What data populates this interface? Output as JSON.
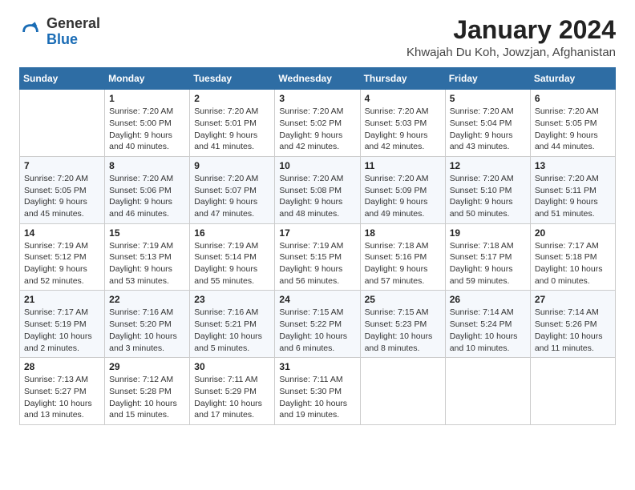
{
  "header": {
    "logo_general": "General",
    "logo_blue": "Blue",
    "month_year": "January 2024",
    "location": "Khwajah Du Koh, Jowzjan, Afghanistan"
  },
  "weekdays": [
    "Sunday",
    "Monday",
    "Tuesday",
    "Wednesday",
    "Thursday",
    "Friday",
    "Saturday"
  ],
  "weeks": [
    [
      {
        "day": "",
        "info": ""
      },
      {
        "day": "1",
        "info": "Sunrise: 7:20 AM\nSunset: 5:00 PM\nDaylight: 9 hours\nand 40 minutes."
      },
      {
        "day": "2",
        "info": "Sunrise: 7:20 AM\nSunset: 5:01 PM\nDaylight: 9 hours\nand 41 minutes."
      },
      {
        "day": "3",
        "info": "Sunrise: 7:20 AM\nSunset: 5:02 PM\nDaylight: 9 hours\nand 42 minutes."
      },
      {
        "day": "4",
        "info": "Sunrise: 7:20 AM\nSunset: 5:03 PM\nDaylight: 9 hours\nand 42 minutes."
      },
      {
        "day": "5",
        "info": "Sunrise: 7:20 AM\nSunset: 5:04 PM\nDaylight: 9 hours\nand 43 minutes."
      },
      {
        "day": "6",
        "info": "Sunrise: 7:20 AM\nSunset: 5:05 PM\nDaylight: 9 hours\nand 44 minutes."
      }
    ],
    [
      {
        "day": "7",
        "info": "Sunrise: 7:20 AM\nSunset: 5:05 PM\nDaylight: 9 hours\nand 45 minutes."
      },
      {
        "day": "8",
        "info": "Sunrise: 7:20 AM\nSunset: 5:06 PM\nDaylight: 9 hours\nand 46 minutes."
      },
      {
        "day": "9",
        "info": "Sunrise: 7:20 AM\nSunset: 5:07 PM\nDaylight: 9 hours\nand 47 minutes."
      },
      {
        "day": "10",
        "info": "Sunrise: 7:20 AM\nSunset: 5:08 PM\nDaylight: 9 hours\nand 48 minutes."
      },
      {
        "day": "11",
        "info": "Sunrise: 7:20 AM\nSunset: 5:09 PM\nDaylight: 9 hours\nand 49 minutes."
      },
      {
        "day": "12",
        "info": "Sunrise: 7:20 AM\nSunset: 5:10 PM\nDaylight: 9 hours\nand 50 minutes."
      },
      {
        "day": "13",
        "info": "Sunrise: 7:20 AM\nSunset: 5:11 PM\nDaylight: 9 hours\nand 51 minutes."
      }
    ],
    [
      {
        "day": "14",
        "info": "Sunrise: 7:19 AM\nSunset: 5:12 PM\nDaylight: 9 hours\nand 52 minutes."
      },
      {
        "day": "15",
        "info": "Sunrise: 7:19 AM\nSunset: 5:13 PM\nDaylight: 9 hours\nand 53 minutes."
      },
      {
        "day": "16",
        "info": "Sunrise: 7:19 AM\nSunset: 5:14 PM\nDaylight: 9 hours\nand 55 minutes."
      },
      {
        "day": "17",
        "info": "Sunrise: 7:19 AM\nSunset: 5:15 PM\nDaylight: 9 hours\nand 56 minutes."
      },
      {
        "day": "18",
        "info": "Sunrise: 7:18 AM\nSunset: 5:16 PM\nDaylight: 9 hours\nand 57 minutes."
      },
      {
        "day": "19",
        "info": "Sunrise: 7:18 AM\nSunset: 5:17 PM\nDaylight: 9 hours\nand 59 minutes."
      },
      {
        "day": "20",
        "info": "Sunrise: 7:17 AM\nSunset: 5:18 PM\nDaylight: 10 hours\nand 0 minutes."
      }
    ],
    [
      {
        "day": "21",
        "info": "Sunrise: 7:17 AM\nSunset: 5:19 PM\nDaylight: 10 hours\nand 2 minutes."
      },
      {
        "day": "22",
        "info": "Sunrise: 7:16 AM\nSunset: 5:20 PM\nDaylight: 10 hours\nand 3 minutes."
      },
      {
        "day": "23",
        "info": "Sunrise: 7:16 AM\nSunset: 5:21 PM\nDaylight: 10 hours\nand 5 minutes."
      },
      {
        "day": "24",
        "info": "Sunrise: 7:15 AM\nSunset: 5:22 PM\nDaylight: 10 hours\nand 6 minutes."
      },
      {
        "day": "25",
        "info": "Sunrise: 7:15 AM\nSunset: 5:23 PM\nDaylight: 10 hours\nand 8 minutes."
      },
      {
        "day": "26",
        "info": "Sunrise: 7:14 AM\nSunset: 5:24 PM\nDaylight: 10 hours\nand 10 minutes."
      },
      {
        "day": "27",
        "info": "Sunrise: 7:14 AM\nSunset: 5:26 PM\nDaylight: 10 hours\nand 11 minutes."
      }
    ],
    [
      {
        "day": "28",
        "info": "Sunrise: 7:13 AM\nSunset: 5:27 PM\nDaylight: 10 hours\nand 13 minutes."
      },
      {
        "day": "29",
        "info": "Sunrise: 7:12 AM\nSunset: 5:28 PM\nDaylight: 10 hours\nand 15 minutes."
      },
      {
        "day": "30",
        "info": "Sunrise: 7:11 AM\nSunset: 5:29 PM\nDaylight: 10 hours\nand 17 minutes."
      },
      {
        "day": "31",
        "info": "Sunrise: 7:11 AM\nSunset: 5:30 PM\nDaylight: 10 hours\nand 19 minutes."
      },
      {
        "day": "",
        "info": ""
      },
      {
        "day": "",
        "info": ""
      },
      {
        "day": "",
        "info": ""
      }
    ]
  ]
}
